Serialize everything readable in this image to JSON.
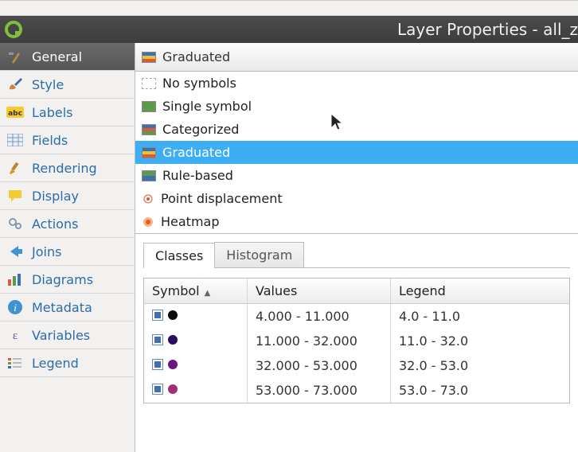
{
  "window": {
    "title": "Layer Properties - all_z"
  },
  "sidebar": {
    "items": [
      {
        "label": "General",
        "icon": "wrench-hammer",
        "selected": true
      },
      {
        "label": "Style",
        "icon": "brush"
      },
      {
        "label": "Labels",
        "icon": "abc"
      },
      {
        "label": "Fields",
        "icon": "table"
      },
      {
        "label": "Rendering",
        "icon": "paintbrush"
      },
      {
        "label": "Display",
        "icon": "speech"
      },
      {
        "label": "Actions",
        "icon": "gears"
      },
      {
        "label": "Joins",
        "icon": "arrow-left"
      },
      {
        "label": "Diagrams",
        "icon": "bar-chart"
      },
      {
        "label": "Metadata",
        "icon": "info"
      },
      {
        "label": "Variables",
        "icon": "epsilon"
      },
      {
        "label": "Legend",
        "icon": "legend"
      }
    ]
  },
  "renderer": {
    "current": "Graduated",
    "options": [
      {
        "label": "No symbols",
        "icon": "none"
      },
      {
        "label": "Single symbol",
        "icon": "single"
      },
      {
        "label": "Categorized",
        "icon": "cat"
      },
      {
        "label": "Graduated",
        "icon": "grad",
        "selected": true
      },
      {
        "label": "Rule-based",
        "icon": "rule"
      },
      {
        "label": "Point displacement",
        "icon": "point"
      },
      {
        "label": "Heatmap",
        "icon": "heat"
      }
    ]
  },
  "tabs": {
    "items": [
      {
        "label": "Classes",
        "active": true
      },
      {
        "label": "Histogram",
        "active": false
      }
    ]
  },
  "table": {
    "columns": {
      "symbol": "Symbol",
      "values": "Values",
      "legend": "Legend"
    },
    "rows": [
      {
        "color": "#0b0b0b",
        "values": "4.000 - 11.000",
        "legend": "4.0 - 11.0"
      },
      {
        "color": "#2e0c5d",
        "values": "11.000 - 32.000",
        "legend": "11.0 - 32.0"
      },
      {
        "color": "#6a1580",
        "values": "32.000 - 53.000",
        "legend": "32.0 - 53.0"
      },
      {
        "color": "#a32d7a",
        "values": "53.000 - 73.000",
        "legend": "53.0 - 73.0"
      }
    ]
  }
}
